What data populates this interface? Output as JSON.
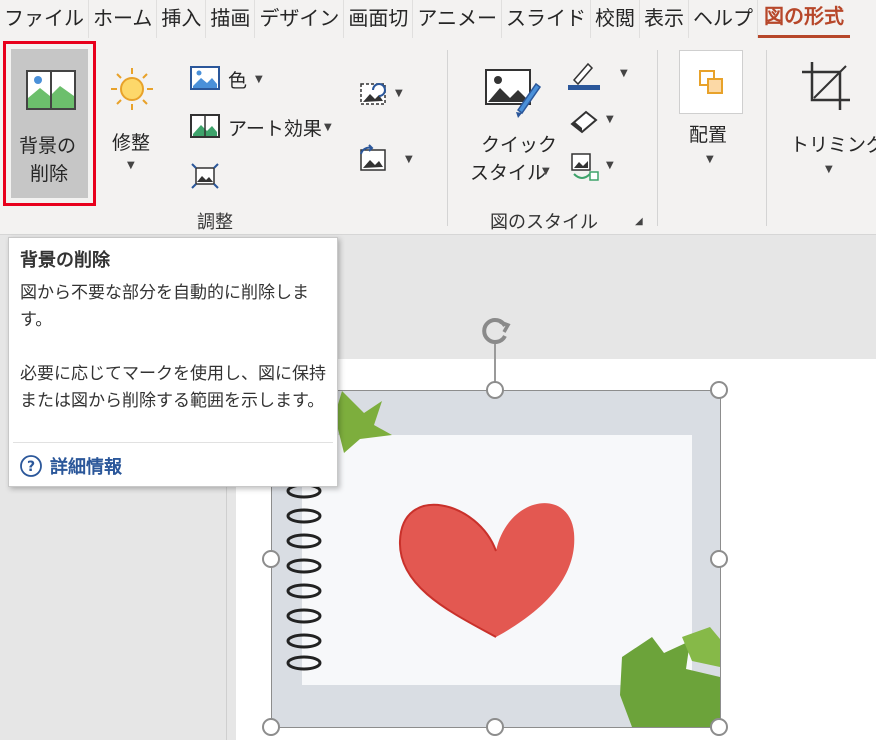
{
  "tabs": [
    {
      "label": "ファイル"
    },
    {
      "label": "ホーム"
    },
    {
      "label": "挿入"
    },
    {
      "label": "描画"
    },
    {
      "label": "デザイン"
    },
    {
      "label": "画面切"
    },
    {
      "label": "アニメー"
    },
    {
      "label": "スライド"
    },
    {
      "label": "校閲"
    },
    {
      "label": "表示"
    },
    {
      "label": "ヘルプ"
    },
    {
      "label": "図の形式",
      "active": true
    }
  ],
  "ribbon": {
    "remove_bg": {
      "line1": "背景の",
      "line2": "削除"
    },
    "corrections": {
      "label": "修整"
    },
    "color": {
      "label": "色"
    },
    "artistic": {
      "label": "アート効果"
    },
    "quick_styles": {
      "line1": "クイック",
      "line2": "スタイル"
    },
    "arrange": {
      "label": "配置"
    },
    "crop": {
      "label": "トリミング"
    },
    "group_adjust": "調整",
    "group_styles": "図のスタイル"
  },
  "tooltip": {
    "title": "背景の削除",
    "body1": "図から不要な部分を自動的に削除します。",
    "body2": "必要に応じてマークを使用し、図に保持または図から削除する範囲を示します。",
    "link": "詳細情報"
  },
  "colors": {
    "accent": "#b7472a",
    "highlight": "#e8001c",
    "link": "#2b579a"
  },
  "image": {
    "description_icon": "heart-notebook-picture"
  }
}
